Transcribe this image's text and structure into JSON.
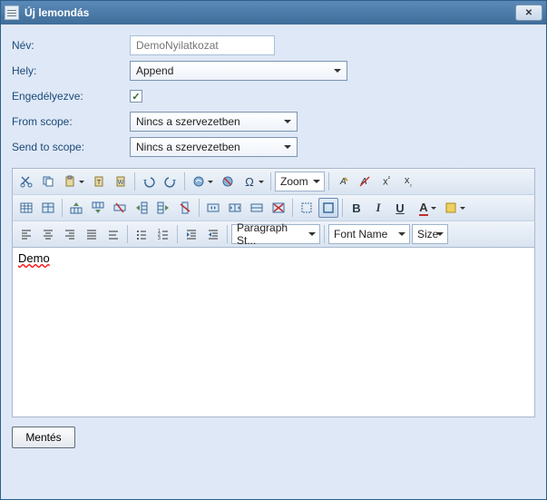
{
  "window": {
    "title": "Új lemondás"
  },
  "form": {
    "name_label": "Név:",
    "name_placeholder": "DemoNyilatkozat",
    "place_label": "Hely:",
    "place_value": "Append",
    "enabled_label": "Engedélyezve:",
    "from_scope_label": "From scope:",
    "from_scope_value": "Nincs a szervezetben",
    "send_scope_label": "Send to scope:",
    "send_scope_value": "Nincs a szervezetben"
  },
  "toolbar": {
    "zoom": "Zoom",
    "para_style": "Paragraph St...",
    "font_name": "Font Name",
    "size": "Size",
    "bold": "B",
    "italic": "I",
    "underline": "U",
    "fontcolor": "A"
  },
  "editor": {
    "text": "Demo"
  },
  "buttons": {
    "save": "Mentés"
  }
}
